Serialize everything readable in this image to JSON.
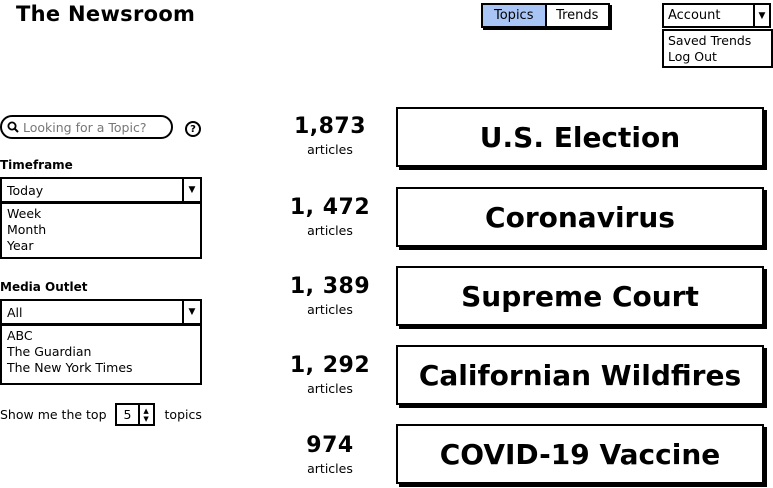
{
  "header": {
    "title": "The Newsroom",
    "tabs": [
      {
        "label": "Topics",
        "active": true
      },
      {
        "label": "Trends",
        "active": false
      }
    ],
    "account": {
      "label": "Account",
      "menu": [
        "Saved Trends",
        "Log Out"
      ]
    }
  },
  "sidebar": {
    "search_placeholder": "Looking for a Topic?",
    "help_symbol": "?",
    "timeframe": {
      "label": "Timeframe",
      "selected": "Today",
      "options": [
        "Week",
        "Month",
        "Year"
      ]
    },
    "media_outlet": {
      "label": "Media Outlet",
      "selected": "All",
      "options": [
        "ABC",
        "The Guardian",
        "The New York Times"
      ]
    },
    "top_n": {
      "prefix": "Show me the top",
      "value": "5",
      "suffix": "topics"
    }
  },
  "topics": [
    {
      "count": "1,873",
      "unit": "articles",
      "name": "U.S. Election"
    },
    {
      "count": "1, 472",
      "unit": "articles",
      "name": "Coronavirus"
    },
    {
      "count": "1, 389",
      "unit": "articles",
      "name": "Supreme Court"
    },
    {
      "count": "1, 292",
      "unit": "articles",
      "name": "Californian Wildfires"
    },
    {
      "count": "974",
      "unit": "articles",
      "name": "COVID-19 Vaccine"
    }
  ],
  "colors": {
    "active_tab": "#a9c5f5"
  }
}
